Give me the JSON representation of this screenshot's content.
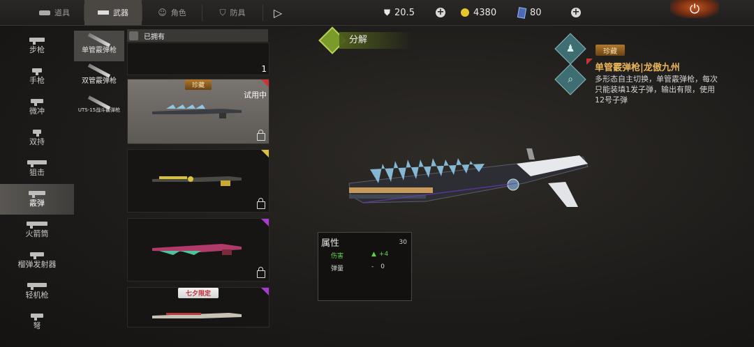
{
  "tabs": [
    {
      "label": "道具",
      "icon": "item-icon"
    },
    {
      "label": "武器",
      "icon": "gun-icon"
    },
    {
      "label": "角色",
      "icon": "character-icon"
    },
    {
      "label": "防具",
      "icon": "shield-icon"
    }
  ],
  "resources": {
    "stamina": "20.5",
    "gold": "4380",
    "cards": "80"
  },
  "categories": [
    "步枪",
    "手枪",
    "微冲",
    "双持",
    "狙击",
    "霰弹",
    "火箭筒",
    "榴弹发射器",
    "轻机枪",
    "弩"
  ],
  "sub_items": [
    "单管霰弹枪",
    "双管霰弹枪",
    "UTS-15战斗霰弹枪"
  ],
  "owned_label": "已拥有",
  "cards": [
    {
      "count": "1"
    },
    {
      "badge": "珍藏",
      "status": "试用中"
    },
    {},
    {},
    {
      "badge": "七夕限定"
    }
  ],
  "decompose_label": "分解",
  "detail": {
    "badge": "珍藏",
    "title": "单管霰弹枪|龙傲九州",
    "description": "多形态自主切换，单管霰弹枪，每次只能装填1发子弹，输出有限，使用12号子弹"
  },
  "attributes": {
    "title": "属性",
    "value": "30",
    "rows": [
      {
        "name": "伤害",
        "value": "+4"
      },
      {
        "name": "弹量",
        "value": "0"
      }
    ]
  },
  "colors": {
    "accent_gold": "#e8b45a",
    "positive_green": "#5fd34a",
    "rarity_red": "#cc3333",
    "rarity_yellow": "#d9c23a",
    "rarity_purple": "#a83ad0"
  }
}
